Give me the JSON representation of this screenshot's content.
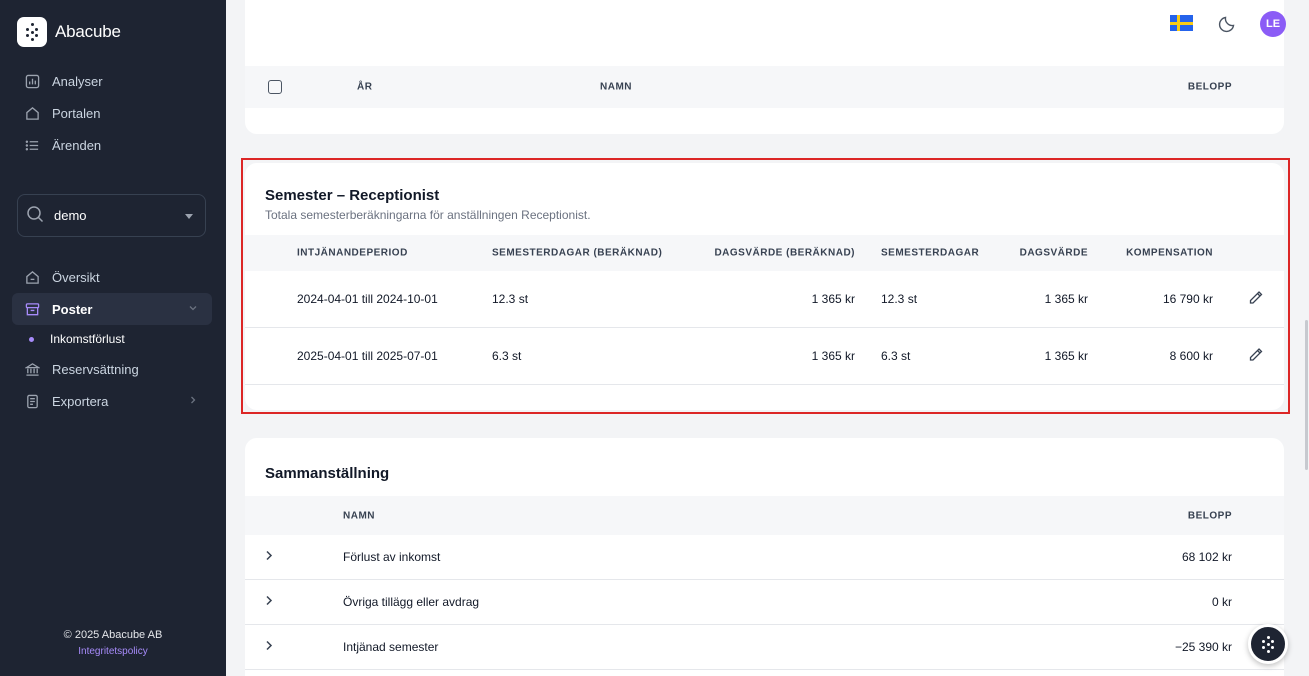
{
  "sidebar": {
    "brand": "Abacube",
    "nav_top": [
      {
        "label": "Analyser",
        "icon": "chart-icon"
      },
      {
        "label": "Portalen",
        "icon": "home-icon"
      },
      {
        "label": "Ärenden",
        "icon": "list-icon"
      }
    ],
    "search_value": "demo",
    "nav_main": [
      {
        "label": "Översikt",
        "icon": "home-icon"
      },
      {
        "label": "Poster",
        "icon": "archive-icon"
      },
      {
        "label": "Inkomstförlust"
      },
      {
        "label": "Reservsättning",
        "icon": "bank-icon"
      },
      {
        "label": "Exportera",
        "icon": "document-icon"
      }
    ],
    "copyright": "© 2025 Abacube AB",
    "privacy_link": "Integritetspolicy"
  },
  "header": {
    "avatar_initials": "LE"
  },
  "top_card": {
    "columns": [
      "ÅR",
      "NAMN",
      "BELOPP"
    ]
  },
  "semester_card": {
    "title": "Semester – Receptionist",
    "subtitle": "Totala semesterberäkningarna för anställningen Receptionist.",
    "columns": [
      "INTJÄNANDEPERIOD",
      "SEMESTERDAGAR (BERÄKNAD)",
      "DAGSVÄRDE (BERÄKNAD)",
      "SEMESTERDAGAR",
      "DAGSVÄRDE",
      "KOMPENSATION"
    ],
    "rows": [
      {
        "period": "2024-04-01 till 2024-10-01",
        "days_calc": "12.3 st",
        "day_value_calc": "1 365 kr",
        "days": "12.3 st",
        "day_value": "1 365 kr",
        "compensation": "16 790 kr"
      },
      {
        "period": "2025-04-01 till 2025-07-01",
        "days_calc": "6.3 st",
        "day_value_calc": "1 365 kr",
        "days": "6.3 st",
        "day_value": "1 365 kr",
        "compensation": "8 600 kr"
      }
    ]
  },
  "summary_card": {
    "title": "Sammanställning",
    "columns": [
      "NAMN",
      "BELOPP"
    ],
    "rows": [
      {
        "name": "Förlust av inkomst",
        "amount": "68 102 kr"
      },
      {
        "name": "Övriga tillägg eller avdrag",
        "amount": "0 kr"
      },
      {
        "name": "Intjänad semester",
        "amount": "−25 390 kr"
      }
    ]
  },
  "colors": {
    "sidebar_bg": "#1e2432",
    "accent": "#8b5cf6",
    "highlight_border": "#dc2626"
  }
}
